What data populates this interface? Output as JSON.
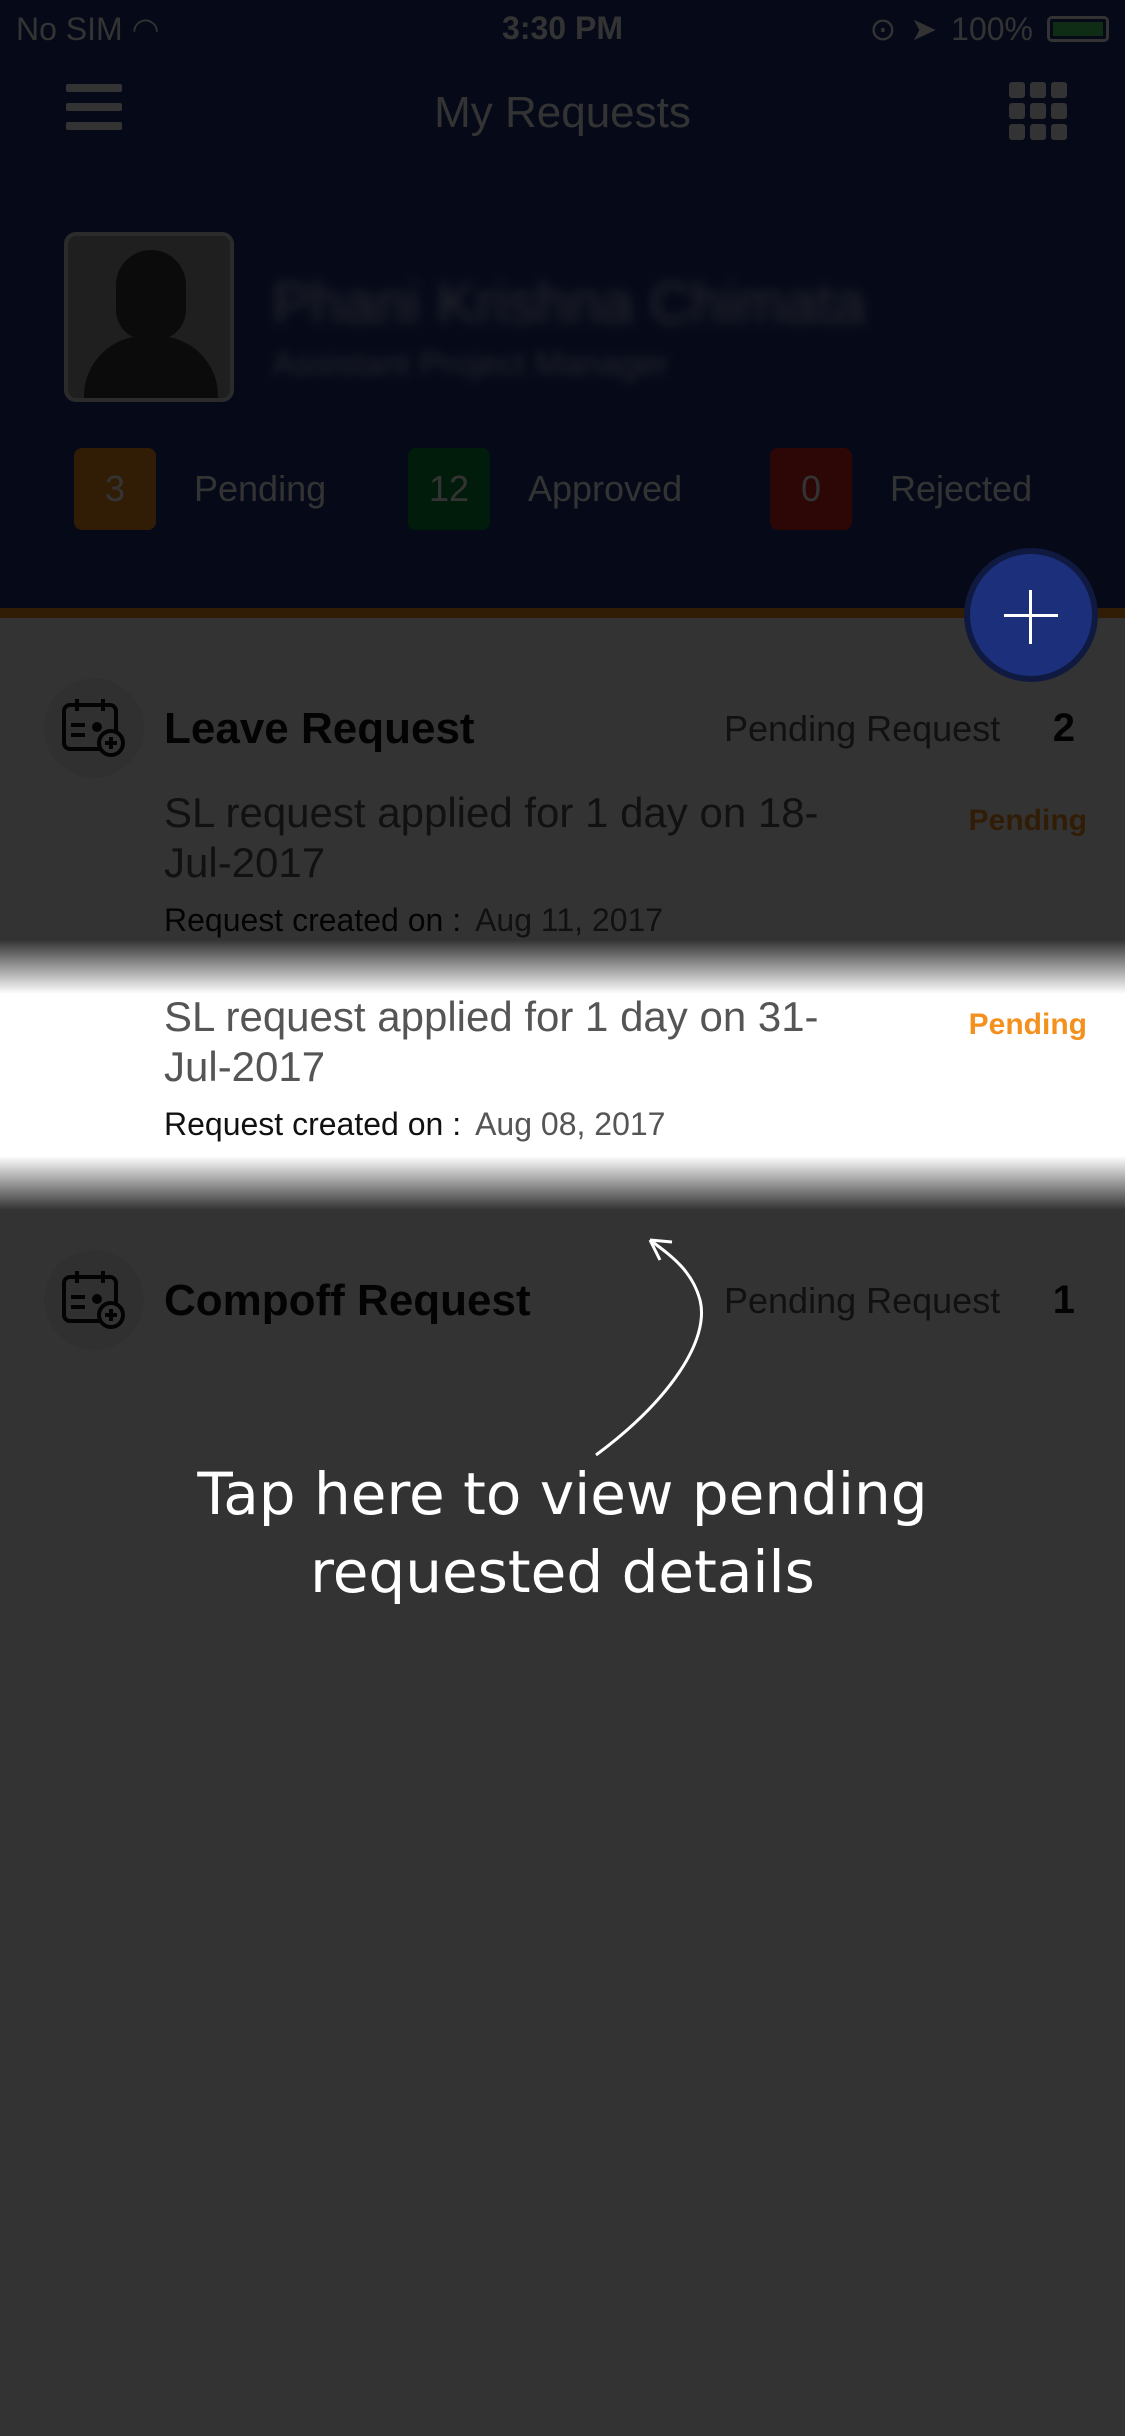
{
  "status_bar": {
    "carrier": "No SIM",
    "time": "3:30 PM",
    "battery": "100%"
  },
  "header": {
    "title": "My Requests",
    "user_name": "Phani Krishna Chimata",
    "user_role": "Assistant Project Manager",
    "stats": [
      {
        "count": "3",
        "label": "Pending",
        "color": "#f3901e"
      },
      {
        "count": "12",
        "label": "Approved",
        "color": "#0e8a3a"
      },
      {
        "count": "0",
        "label": "Rejected",
        "color": "#e02020"
      }
    ]
  },
  "sections": [
    {
      "title": "Leave Request",
      "pending_label": "Pending Request",
      "pending_count": "2",
      "items": [
        {
          "text": "SL request applied for 1 day on 18-Jul-2017",
          "created_label": "Request created on :",
          "created_date": "Aug 11, 2017",
          "status": "Pending"
        },
        {
          "text": "SL request applied for 1 day on 31-Jul-2017",
          "created_label": "Request created on :",
          "created_date": "Aug 08, 2017",
          "status": "Pending"
        }
      ]
    },
    {
      "title": "Compoff Request",
      "pending_label": "Pending Request",
      "pending_count": "1",
      "items": []
    }
  ],
  "overlay": {
    "hint_line1": "Tap here to view pending",
    "hint_line2": "requested details"
  },
  "colors": {
    "header_bg": "#1b2f7a",
    "accent": "#f3901e",
    "overlay_dim": "rgba(0,0,0,0.80)"
  }
}
